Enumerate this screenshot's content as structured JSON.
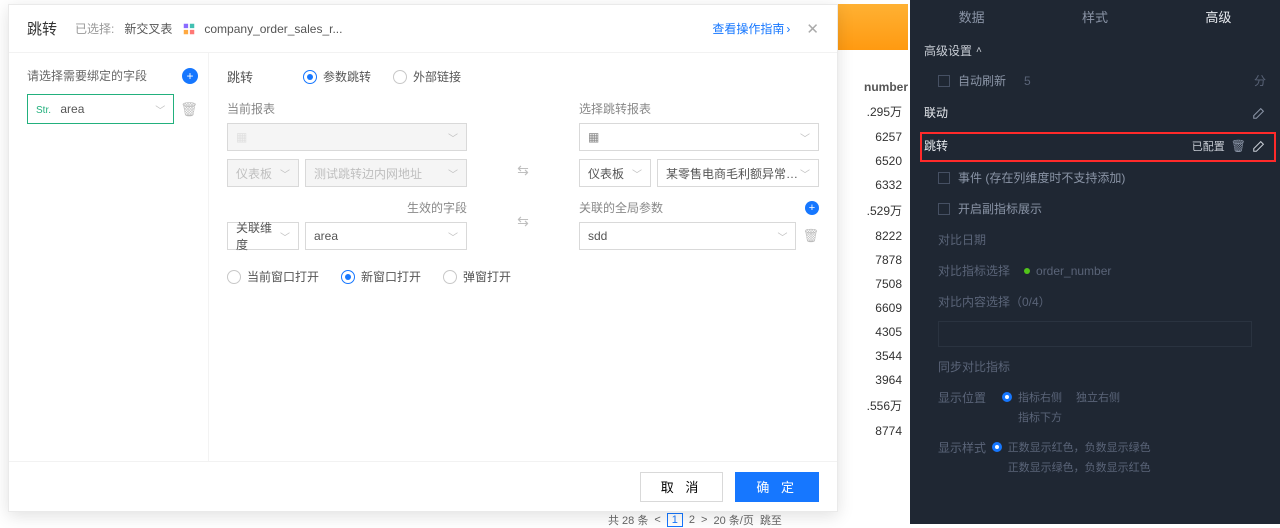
{
  "right_panel": {
    "tabs": [
      "数据",
      "样式",
      "高级"
    ],
    "active_tab": "高级",
    "section_title": "高级设置",
    "auto_refresh": {
      "label": "自动刷新",
      "value": "5",
      "unit": "分"
    },
    "linkage": {
      "label": "联动"
    },
    "jump": {
      "label": "跳转",
      "status": "已配置"
    },
    "event": {
      "label": "事件 (存在列维度时不支持添加)"
    },
    "sub_metric": {
      "label": "开启副指标展示"
    },
    "compare_date": "对比日期",
    "compare_metric_label": "对比指标选择",
    "compare_metric_value": "order_number",
    "compare_content": "对比内容选择（0/4）",
    "sync_metric": "同步对比指标",
    "show_position": {
      "label": "显示位置",
      "opt1": "指标右侧",
      "opt2": "独立右侧",
      "opt3": "指标下方"
    },
    "show_style": {
      "label": "显示样式",
      "opt1": "正数显示红色，负数显示绿色",
      "opt2": "正数显示绿色，负数显示红色"
    }
  },
  "bg": {
    "header": "number",
    "rows": [
      ".295万",
      "6257",
      "6520",
      "6332",
      ".529万",
      "8222",
      "7878",
      "7508",
      "6609",
      "4305",
      "3544",
      "3964",
      ".556万",
      "8774"
    ],
    "pager_total": "共 28 条",
    "pager_pages": [
      "1",
      "2"
    ],
    "pager_size": "20 条/页",
    "pager_jump": "跳至"
  },
  "modal": {
    "title": "跳转",
    "selected_prefix": "已选择:",
    "crosstab_name": "新交叉表",
    "dataset_name": "company_order_sales_r...",
    "guide": "查看操作指南",
    "left": {
      "hint": "请选择需要绑定的字段",
      "field_tag": "Str.",
      "field": "area"
    },
    "form": {
      "jump_label": "跳转",
      "radio_param": "参数跳转",
      "radio_external": "外部链接",
      "current_report": "当前报表",
      "select_target": "选择跳转报表",
      "dashboard": "仪表板",
      "intranet": "测试跳转边内网地址",
      "ecom": "某零售电商毛利额异常下滑",
      "effective_field": "生效的字段",
      "global_params": "关联的全局参数",
      "relate_dim": "关联维度",
      "area": "area",
      "sdd": "sdd",
      "open_current": "当前窗口打开",
      "open_new": "新窗口打开",
      "open_popup": "弹窗打开"
    },
    "footer": {
      "cancel": "取 消",
      "ok": "确 定"
    }
  }
}
